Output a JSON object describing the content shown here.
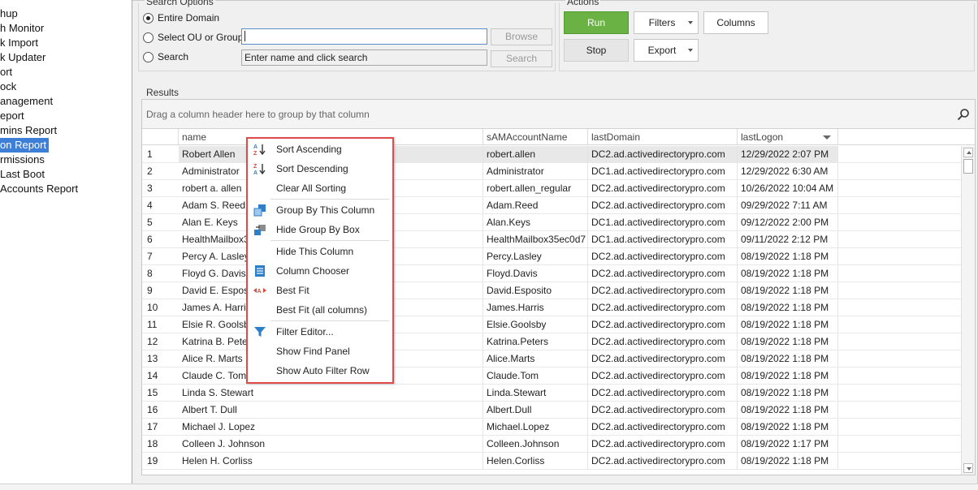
{
  "sidebar": {
    "items": [
      {
        "label": "hup"
      },
      {
        "label": "h Monitor"
      },
      {
        "label": "k Import"
      },
      {
        "label": "k Updater"
      },
      {
        "label": "ort"
      },
      {
        "label": "ock"
      },
      {
        "label": "anagement"
      },
      {
        "label": "eport"
      },
      {
        "label": "mins Report"
      },
      {
        "label": "on Report"
      },
      {
        "label": "rmissions"
      },
      {
        "label": "Last Boot"
      },
      {
        "label": "Accounts Report"
      }
    ],
    "selected_index": 9
  },
  "search_options": {
    "title": "Search Options",
    "entire_domain_label": "Entire Domain",
    "select_ou_label": "Select OU or Group",
    "search_label": "Search",
    "ou_value": "",
    "search_placeholder": "Enter name and click search",
    "browse_label": "Browse",
    "search_button_label": "Search"
  },
  "actions": {
    "title": "Actions",
    "run_label": "Run",
    "stop_label": "Stop",
    "filters_label": "Filters",
    "export_label": "Export",
    "columns_label": "Columns"
  },
  "results": {
    "title": "Results",
    "group_panel_text": "Drag a column header here to group by that column",
    "columns": [
      "name",
      "sAMAccountName",
      "lastDomain",
      "lastLogon"
    ],
    "rows": [
      {
        "n": "1",
        "name": "Robert Allen",
        "sam": "robert.allen",
        "domain": "DC2.ad.activedirectorypro.com",
        "logon": "12/29/2022 2:07 PM"
      },
      {
        "n": "2",
        "name": "Administrator",
        "sam": "Administrator",
        "domain": "DC1.ad.activedirectorypro.com",
        "logon": "12/29/2022 6:30 AM"
      },
      {
        "n": "3",
        "name": "robert a. allen",
        "sam": "robert.allen_regular",
        "domain": "DC2.ad.activedirectorypro.com",
        "logon": "10/26/2022 10:04 AM"
      },
      {
        "n": "4",
        "name": "Adam S. Reed",
        "sam": "Adam.Reed",
        "domain": "DC2.ad.activedirectorypro.com",
        "logon": "09/29/2022 7:11 AM"
      },
      {
        "n": "5",
        "name": "Alan E. Keys",
        "sam": "Alan.Keys",
        "domain": "DC1.ad.activedirectorypro.com",
        "logon": "09/12/2022 2:00 PM"
      },
      {
        "n": "6",
        "name": "HealthMailbox35",
        "sam": "HealthMailbox35ec0d7",
        "domain": "DC1.ad.activedirectorypro.com",
        "logon": "09/11/2022 2:12 PM"
      },
      {
        "n": "7",
        "name": "Percy A. Lasley",
        "sam": "Percy.Lasley",
        "domain": "DC2.ad.activedirectorypro.com",
        "logon": "08/19/2022 1:18 PM"
      },
      {
        "n": "8",
        "name": "Floyd G. Davis",
        "sam": "Floyd.Davis",
        "domain": "DC2.ad.activedirectorypro.com",
        "logon": "08/19/2022 1:18 PM"
      },
      {
        "n": "9",
        "name": "David E. Esposito",
        "sam": "David.Esposito",
        "domain": "DC2.ad.activedirectorypro.com",
        "logon": "08/19/2022 1:18 PM"
      },
      {
        "n": "10",
        "name": "James A. Harris",
        "sam": "James.Harris",
        "domain": "DC2.ad.activedirectorypro.com",
        "logon": "08/19/2022 1:18 PM"
      },
      {
        "n": "11",
        "name": "Elsie R. Goolsby",
        "sam": "Elsie.Goolsby",
        "domain": "DC2.ad.activedirectorypro.com",
        "logon": "08/19/2022 1:18 PM"
      },
      {
        "n": "12",
        "name": "Katrina B. Peters",
        "sam": "Katrina.Peters",
        "domain": "DC2.ad.activedirectorypro.com",
        "logon": "08/19/2022 1:18 PM"
      },
      {
        "n": "13",
        "name": "Alice R. Marts",
        "sam": "Alice.Marts",
        "domain": "DC2.ad.activedirectorypro.com",
        "logon": "08/19/2022 1:18 PM"
      },
      {
        "n": "14",
        "name": "Claude C. Tom",
        "sam": "Claude.Tom",
        "domain": "DC2.ad.activedirectorypro.com",
        "logon": "08/19/2022 1:18 PM"
      },
      {
        "n": "15",
        "name": "Linda S. Stewart",
        "sam": "Linda.Stewart",
        "domain": "DC2.ad.activedirectorypro.com",
        "logon": "08/19/2022 1:18 PM"
      },
      {
        "n": "16",
        "name": "Albert T. Dull",
        "sam": "Albert.Dull",
        "domain": "DC2.ad.activedirectorypro.com",
        "logon": "08/19/2022 1:18 PM"
      },
      {
        "n": "17",
        "name": "Michael J. Lopez",
        "sam": "Michael.Lopez",
        "domain": "DC2.ad.activedirectorypro.com",
        "logon": "08/19/2022 1:18 PM"
      },
      {
        "n": "18",
        "name": "Colleen J. Johnson",
        "sam": "Colleen.Johnson",
        "domain": "DC2.ad.activedirectorypro.com",
        "logon": "08/19/2022 1:17 PM"
      },
      {
        "n": "19",
        "name": "Helen H. Corliss",
        "sam": "Helen.Corliss",
        "domain": "DC2.ad.activedirectorypro.com",
        "logon": "08/19/2022 1:18 PM"
      }
    ]
  },
  "context_menu": {
    "items": [
      {
        "label": "Sort Ascending",
        "icon": "sort-ascending-icon"
      },
      {
        "label": "Sort Descending",
        "icon": "sort-descending-icon"
      },
      {
        "label": "Clear All Sorting",
        "icon": ""
      },
      {
        "label": "Group By This Column",
        "icon": "group-by-column-icon"
      },
      {
        "label": "Hide Group By Box",
        "icon": "hide-group-box-icon"
      },
      {
        "label": "Hide This Column",
        "icon": ""
      },
      {
        "label": "Column Chooser",
        "icon": "column-chooser-icon"
      },
      {
        "label": "Best Fit",
        "icon": "best-fit-icon"
      },
      {
        "label": "Best Fit (all columns)",
        "icon": ""
      },
      {
        "label": "Filter Editor...",
        "icon": "filter-icon"
      },
      {
        "label": "Show Find Panel",
        "icon": ""
      },
      {
        "label": "Show Auto Filter Row",
        "icon": ""
      }
    ]
  },
  "colors": {
    "run_green": "#6ab244",
    "selection_blue": "#3d7fd6",
    "menu_border_red": "#e04a4a",
    "icon_blue": "#2f7fc8"
  }
}
